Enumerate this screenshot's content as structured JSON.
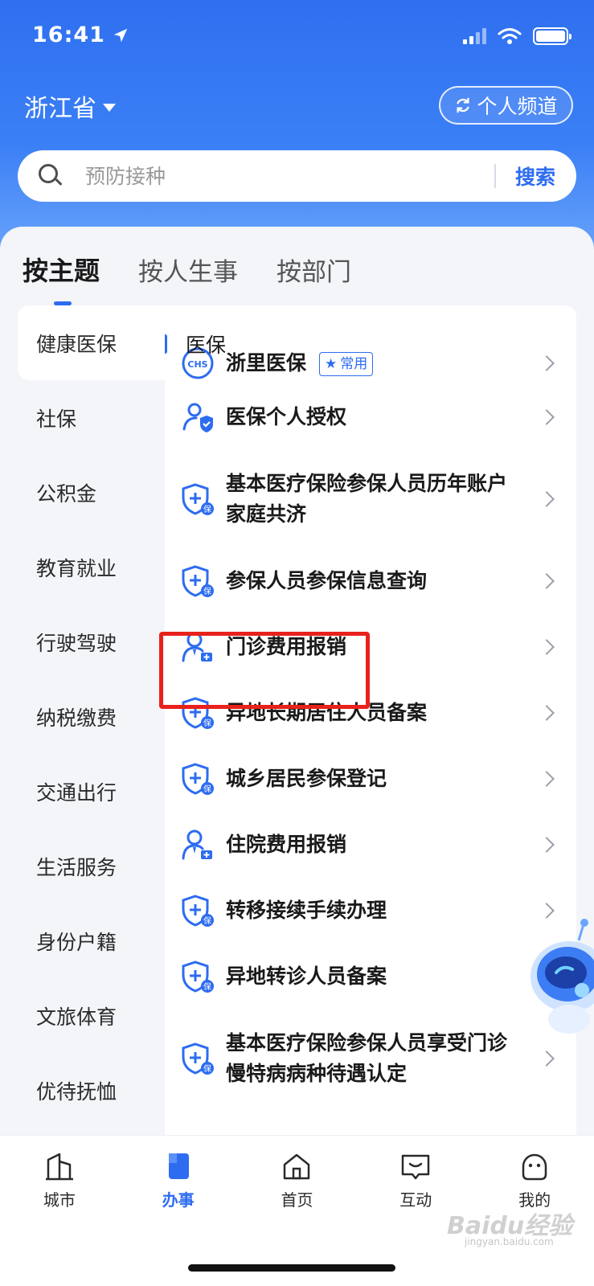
{
  "status_bar": {
    "time": "16:41"
  },
  "header": {
    "province": "浙江省",
    "channel_button": "个人频道",
    "search_placeholder": "预防接种",
    "search_button": "搜索"
  },
  "tabs": [
    {
      "label": "按主题",
      "active": true
    },
    {
      "label": "按人生事",
      "active": false
    },
    {
      "label": "按部门",
      "active": false
    }
  ],
  "categories": [
    {
      "label": "健康医保",
      "active": true
    },
    {
      "label": "社保"
    },
    {
      "label": "公积金"
    },
    {
      "label": "教育就业"
    },
    {
      "label": "行驶驾驶"
    },
    {
      "label": "纳税缴费"
    },
    {
      "label": "交通出行"
    },
    {
      "label": "生活服务"
    },
    {
      "label": "身份户籍"
    },
    {
      "label": "文旅体育"
    },
    {
      "label": "优待抚恤"
    }
  ],
  "section": {
    "title": "医保"
  },
  "services": [
    {
      "label": "浙里医保",
      "icon": "chs-icon",
      "badge": "常用"
    },
    {
      "label": "医保个人授权",
      "icon": "person-check-icon"
    },
    {
      "label": "基本医疗保险参保人员历年账户家庭共济",
      "icon": "insurance-shield-icon"
    },
    {
      "label": "参保人员参保信息查询",
      "icon": "insurance-shield-icon"
    },
    {
      "label": "门诊费用报销",
      "icon": "person-medical-icon",
      "highlighted": true
    },
    {
      "label": "异地长期居住人员备案",
      "icon": "insurance-shield-icon"
    },
    {
      "label": "城乡居民参保登记",
      "icon": "insurance-shield-icon"
    },
    {
      "label": "住院费用报销",
      "icon": "person-medical-icon"
    },
    {
      "label": "转移接续手续办理",
      "icon": "insurance-shield-icon"
    },
    {
      "label": "异地转诊人员备案",
      "icon": "insurance-shield-icon"
    },
    {
      "label": "基本医疗保险参保人员享受门诊慢特病病种待遇认定",
      "icon": "insurance-shield-icon"
    }
  ],
  "bottom_tabs": [
    {
      "label": "城市",
      "icon": "city-icon"
    },
    {
      "label": "办事",
      "icon": "task-icon",
      "active": true
    },
    {
      "label": "首页",
      "icon": "home-icon"
    },
    {
      "label": "互动",
      "icon": "chat-icon"
    },
    {
      "label": "我的",
      "icon": "profile-icon"
    }
  ],
  "watermark": {
    "text": "Baidu经验",
    "sub": "jingyan.baidu.com"
  },
  "colors": {
    "primary": "#2d6cf0",
    "highlight": "#e8211c",
    "header": "#3b80f6"
  }
}
